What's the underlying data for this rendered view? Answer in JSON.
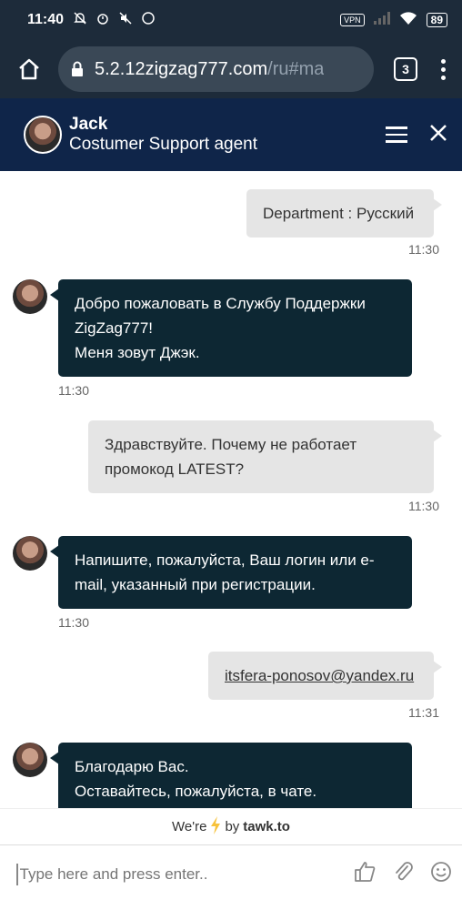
{
  "status": {
    "time": "11:40",
    "vpn": "VPN",
    "battery": "89"
  },
  "browser": {
    "url_main": "5.2.12zigzag777.com",
    "url_rest": "/ru#ma",
    "tab_count": "3"
  },
  "header": {
    "agent_name": "Jack",
    "agent_role": "Costumer Support agent"
  },
  "messages": [
    {
      "from": "visitor",
      "lines": [
        "Department : Русский"
      ],
      "time": "11:30"
    },
    {
      "from": "agent",
      "lines": [
        "Добро пожаловать в Службу Поддержки",
        "ZigZag777!",
        "Меня зовут Джэк."
      ],
      "time": "11:30"
    },
    {
      "from": "visitor",
      "lines": [
        "Здравствуйте. Почему не работает",
        "промокод LATEST?"
      ],
      "time": "11:30"
    },
    {
      "from": "agent",
      "lines": [
        "Напишите, пожалуйста, Ваш логин или e-",
        "mail, указанный при регистрации."
      ],
      "time": "11:30"
    },
    {
      "from": "visitor",
      "lines": [
        "itsfera-ponosov@yandex.ru"
      ],
      "time": "11:31"
    },
    {
      "from": "agent",
      "lines": [
        "Благодарю Вас.",
        "Оставайтесь, пожалуйста, в чате."
      ]
    }
  ],
  "footer": {
    "were": "We're",
    "by": "by",
    "brand": "tawk.to"
  },
  "composer": {
    "placeholder": "Type here and press enter.."
  },
  "colors": {
    "header_bg": "#0f2549",
    "agent_bubble": "#0d2733",
    "visitor_bubble": "#e5e5e5"
  }
}
